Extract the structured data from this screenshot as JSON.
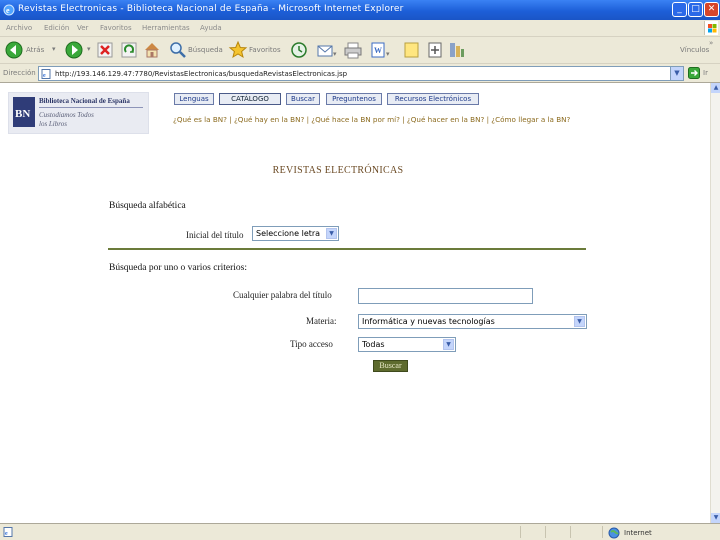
{
  "window": {
    "title": "Revistas Electronicas - Biblioteca Nacional de España - Microsoft Internet Explorer",
    "minimize": "_",
    "maximize": "□",
    "close": "✕"
  },
  "menu": [
    "Archivo",
    "Edición",
    "Ver",
    "Favoritos",
    "Herramientas",
    "Ayuda"
  ],
  "toolbar": {
    "back_label": "Atrás",
    "search_label": "Búsqueda",
    "favorites_label": "Favoritos",
    "links_label": "Vínculos",
    "icons": [
      "back-icon",
      "forward-icon",
      "stop-icon",
      "refresh-icon",
      "home-icon",
      "search-icon",
      "favorites-star-icon",
      "history-icon",
      "mail-icon",
      "print-icon",
      "edit-icon",
      "messenger-icon",
      "discuss-icon"
    ]
  },
  "address": {
    "label": "Dirección",
    "url": "http://193.146.129.47:7780/RevistasElectronicas/busquedaRevistasElectronicas.jsp",
    "go_label": "Ir"
  },
  "site": {
    "logo": {
      "mark": "BN",
      "name": "Biblioteca Nacional de España",
      "slogan_line1": "Custodiamos Todos",
      "slogan_line2": "los Libros"
    },
    "nav_buttons": [
      "Lenguas",
      "CATÁLOGO",
      "Buscar",
      "Preguntenos",
      "Recursos Electrónicos"
    ],
    "links_row": "¿Qué es la BN? | ¿Qué hay en la BN? | ¿Qué hace la BN por mí? | ¿Qué hacer en la BN? | ¿Cómo llegar a la BN?"
  },
  "main": {
    "heading": "REVISTAS ELECTRÓNICAS",
    "alpha_section_title": "Búsqueda alfabética",
    "initial_label": "Inicial del título",
    "initial_select_value": "Seleccione letra",
    "criteria_section_title": "Búsqueda por uno o varios criterios:",
    "title_word_label": "Cualquier palabra del título",
    "title_word_value": "",
    "subject_label": "Materia:",
    "subject_value": "Informática y nuevas tecnologías",
    "access_label": "Tipo acceso",
    "access_value": "Todas",
    "search_button": "Buscar"
  },
  "status": {
    "text": "",
    "zone": "Internet"
  },
  "colors": {
    "titlebar": "#1d5fd8",
    "chrome": "#ece9d8",
    "heading_brown": "#6b4a24",
    "link_gold": "#8c6b1f",
    "divider_olive": "#6b7b3a",
    "button_olive": "#5e6b2e"
  }
}
